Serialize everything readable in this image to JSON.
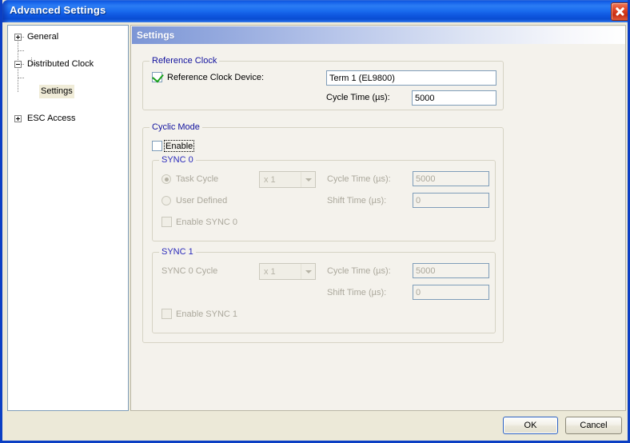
{
  "window": {
    "title": "Advanced Settings",
    "close_icon": "close-icon"
  },
  "tree": {
    "nodes": [
      {
        "label": "General",
        "expander": "+",
        "selected": false
      },
      {
        "label": "Distributed Clock",
        "expander": "-",
        "selected": false
      },
      {
        "label": "Settings",
        "expander": "",
        "selected": true
      },
      {
        "label": "ESC Access",
        "expander": "+",
        "selected": false
      }
    ]
  },
  "panel": {
    "header": "Settings"
  },
  "reference_clock": {
    "legend": "Reference Clock",
    "device_checkbox_label": "Reference Clock Device:",
    "device_checked": true,
    "device_value": "Term 1 (EL9800)",
    "cycle_time_label": "Cycle Time (µs):",
    "cycle_time_value": "5000"
  },
  "cyclic_mode": {
    "legend": "Cyclic Mode",
    "enable_label": "Enable",
    "enable_checked": false,
    "sync0": {
      "legend": "SYNC 0",
      "task_cycle_label": "Task Cycle",
      "task_cycle_selected": true,
      "user_defined_label": "User Defined",
      "user_defined_selected": false,
      "multiplier_value": "x 1",
      "cycle_time_label": "Cycle Time (µs):",
      "cycle_time_value": "5000",
      "shift_time_label": "Shift Time (µs):",
      "shift_time_value": "0",
      "enable_label": "Enable SYNC 0",
      "enable_checked": false
    },
    "sync1": {
      "legend": "SYNC 1",
      "sync0_cycle_label": "SYNC 0 Cycle",
      "multiplier_value": "x 1",
      "cycle_time_label": "Cycle Time (µs):",
      "cycle_time_value": "5000",
      "shift_time_label": "Shift Time (µs):",
      "shift_time_value": "0",
      "enable_label": "Enable SYNC 1",
      "enable_checked": false
    }
  },
  "footer": {
    "ok_label": "OK",
    "cancel_label": "Cancel"
  },
  "colors": {
    "titlebar_blue": "#0b4ed4",
    "dialog_face": "#ece9d8",
    "panel_face": "#f4f2ec",
    "field_border": "#7f9db9",
    "legend_text": "#11119e",
    "disabled_text": "#aba89c",
    "close_red": "#c62d12",
    "check_green": "#18a018"
  }
}
